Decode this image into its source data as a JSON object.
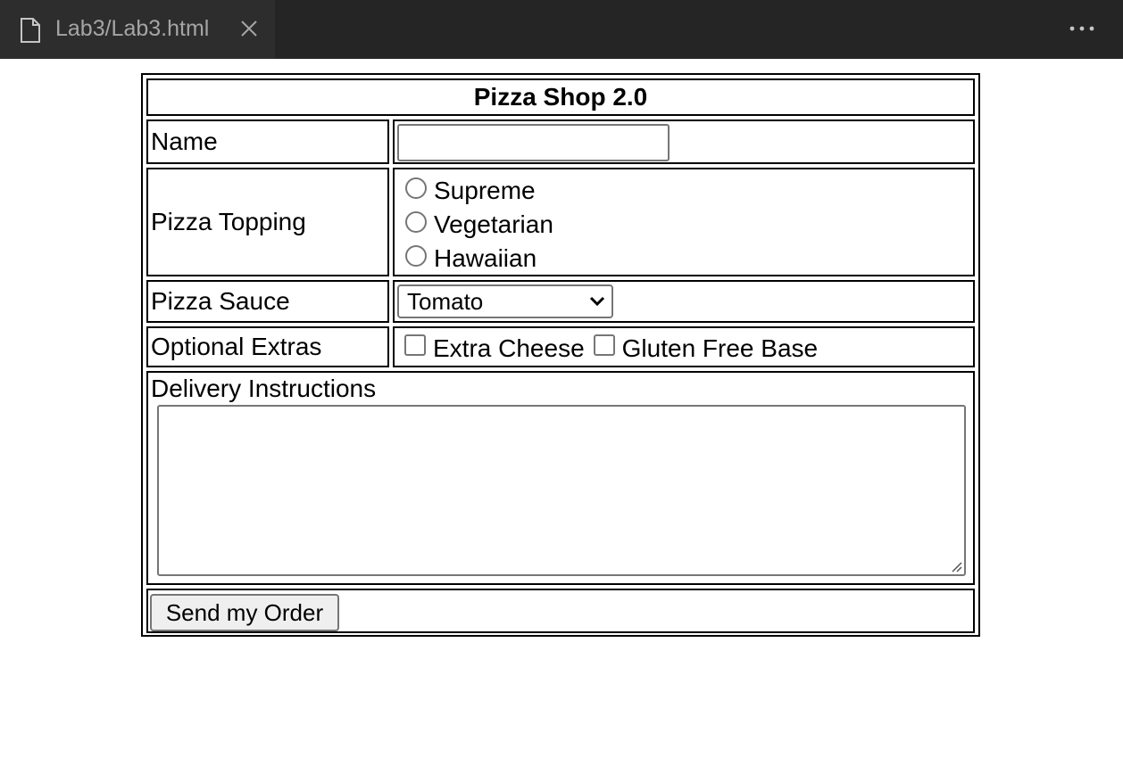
{
  "editor": {
    "tab_title": "Lab3/Lab3.html",
    "icons": {
      "file": "file-icon",
      "close": "close-icon",
      "more": "more-actions-icon"
    }
  },
  "form": {
    "title": "Pizza Shop 2.0",
    "name_label": "Name",
    "name_value": "",
    "topping_label": "Pizza Topping",
    "toppings": [
      "Supreme",
      "Vegetarian",
      "Hawaiian"
    ],
    "sauce_label": "Pizza Sauce",
    "sauce_selected": "Tomato",
    "extras_label": "Optional Extras",
    "extras": [
      "Extra Cheese",
      "Gluten Free Base"
    ],
    "delivery_label": "Delivery Instructions",
    "delivery_value": "",
    "submit_label": "Send my Order"
  }
}
